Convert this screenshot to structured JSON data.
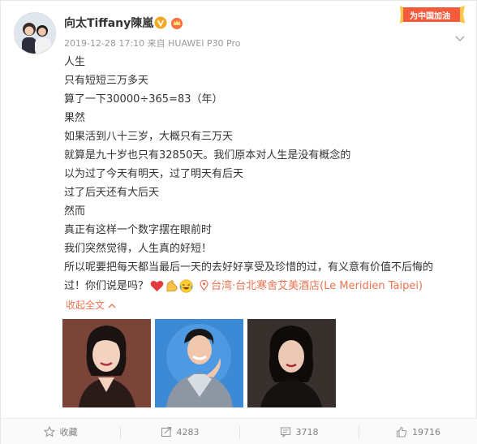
{
  "post": {
    "username": "向太Tiffany陳嵐",
    "meta": "2019-12-28 17:10 来自 HUAWEI P30 Pro",
    "badge_text": "为中国加油",
    "lines": [
      "人生",
      "只有短短三万多天",
      "算了一下30000÷365=83（年）",
      "果然",
      "如果活到八十三岁，大概只有三万天",
      "就算是九十岁也只有32850天。我们原本对人生是没有概念的",
      "以为过了今天有明天，过了明天有后天",
      "过了后天还有大后天",
      "然而",
      "真正有这样一个数字摆在眼前时",
      "我们突然觉得，人生真的好短！",
      "所以呢要把每天都当最后一天的去好好享受及珍惜的过，有义意有价值不后悔的"
    ],
    "last_line": "过！你们说是吗？",
    "emojis": [
      "heart-icon",
      "flexed-arm-icon",
      "laughing-face-icon"
    ],
    "location": "台湾·台北寒舍艾美酒店(Le Meridien Taipei)",
    "collapse_label": "收起全文",
    "photos": [
      "photo-woman-smiling",
      "photo-man-blue-backdrop",
      "photo-woman-portrait"
    ]
  },
  "footer": {
    "favorite_label": "收藏",
    "repost_count": "4283",
    "comment_count": "3718",
    "like_count": "19716"
  },
  "colors": {
    "accent": "#eb7350",
    "text": "#333333",
    "meta": "#999999",
    "verified": "#f5a623"
  }
}
